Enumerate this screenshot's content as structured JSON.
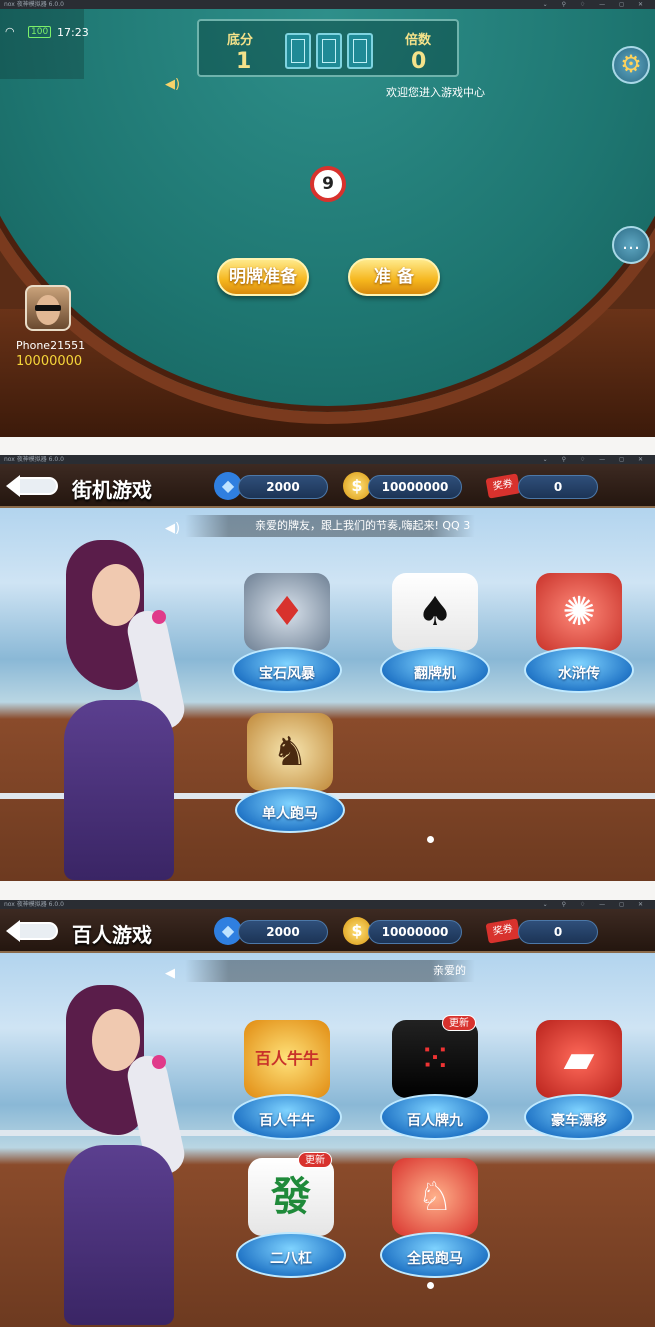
{
  "emulator": {
    "title": "nox 夜神模拟器 6.0.0",
    "controls": "⌄ ⚲ ♢ — ◻ ✕"
  },
  "game_room": {
    "status": {
      "battery": "100",
      "time": "17:23"
    },
    "base_score": {
      "label": "底分",
      "value": "1"
    },
    "multiplier": {
      "label": "倍数",
      "value": "0"
    },
    "marquee": "欢迎您进入游戏中心",
    "timer": "9",
    "show_cards_ready_label": "明牌准备",
    "ready_label": "准 备",
    "player": {
      "name": "Phone21551",
      "coins": "10000000"
    }
  },
  "arcade": {
    "title": "街机游戏",
    "diamonds": "2000",
    "coins": "10000000",
    "ticket_label": "奖券",
    "tickets": "0",
    "marquee": "亲爱的牌友，跟上我们的节奏,嗨起来! QQ 3",
    "games": [
      {
        "label": "宝石风暴",
        "icon": "gem-machine-icon"
      },
      {
        "label": "翻牌机",
        "icon": "playing-cards-icon"
      },
      {
        "label": "水浒传",
        "icon": "squid-icon"
      },
      {
        "label": "单人跑马",
        "icon": "horse-icon"
      }
    ]
  },
  "hundred": {
    "title": "百人游戏",
    "diamonds": "2000",
    "coins": "10000000",
    "ticket_label": "奖券",
    "tickets": "0",
    "marquee": "亲爱的",
    "new_tag": "更新",
    "games": [
      {
        "label": "百人牛牛",
        "icon": "bull-icon"
      },
      {
        "label": "百人牌九",
        "icon": "dominoes-icon"
      },
      {
        "label": "豪车漂移",
        "icon": "sports-car-icon"
      },
      {
        "label": "二八杠",
        "icon": "mahjong-tile-icon"
      },
      {
        "label": "全民跑马",
        "icon": "jockey-icon"
      }
    ],
    "badge_text": {
      "bull": "百人牛牛",
      "mahjong": "發"
    }
  },
  "colors": {
    "table": "#1e7671",
    "gold": "#f5b51c",
    "accent_red": "#d8322d",
    "pill_blue": "#1c3456"
  }
}
